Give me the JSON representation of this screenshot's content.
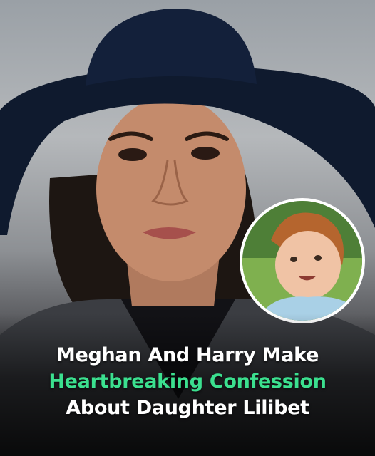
{
  "headline": {
    "line1": "Meghan And Harry Make",
    "line2": "Heartbreaking Confession",
    "line3": "About Daughter Lilibet"
  },
  "colors": {
    "headline_white": "#ffffff",
    "headline_green": "#3be08f",
    "inset_border": "#ffffff",
    "hat": "#0f1a2e"
  }
}
